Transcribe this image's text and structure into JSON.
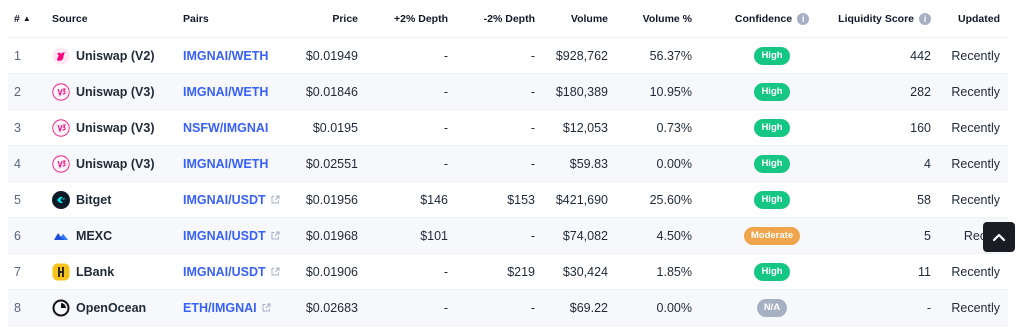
{
  "headers": {
    "num": "#",
    "sort_glyph": "▲",
    "source": "Source",
    "pairs": "Pairs",
    "price": "Price",
    "depth_plus": "+2% Depth",
    "depth_minus": "-2% Depth",
    "volume": "Volume",
    "volume_pct": "Volume %",
    "confidence": "Confidence",
    "liquidity": "Liquidity Score",
    "updated": "Updated"
  },
  "rows": [
    {
      "num": "1",
      "source": "Uniswap (V2)",
      "logo": "uniswap-v2-icon",
      "pair": "IMGNAI/WETH",
      "ext": false,
      "price": "$0.01949",
      "depth_plus": "-",
      "depth_minus": "-",
      "volume": "$928,762",
      "volume_pct": "56.37%",
      "confidence": "High",
      "liquidity": "442",
      "updated": "Recently"
    },
    {
      "num": "2",
      "source": "Uniswap (V3)",
      "logo": "uniswap-v3-icon",
      "pair": "IMGNAI/WETH",
      "ext": false,
      "price": "$0.01846",
      "depth_plus": "-",
      "depth_minus": "-",
      "volume": "$180,389",
      "volume_pct": "10.95%",
      "confidence": "High",
      "liquidity": "282",
      "updated": "Recently"
    },
    {
      "num": "3",
      "source": "Uniswap (V3)",
      "logo": "uniswap-v3-icon",
      "pair": "NSFW/IMGNAI",
      "ext": false,
      "price": "$0.0195",
      "depth_plus": "-",
      "depth_minus": "-",
      "volume": "$12,053",
      "volume_pct": "0.73%",
      "confidence": "High",
      "liquidity": "160",
      "updated": "Recently"
    },
    {
      "num": "4",
      "source": "Uniswap (V3)",
      "logo": "uniswap-v3-icon",
      "pair": "IMGNAI/WETH",
      "ext": false,
      "price": "$0.02551",
      "depth_plus": "-",
      "depth_minus": "-",
      "volume": "$59.83",
      "volume_pct": "0.00%",
      "confidence": "High",
      "liquidity": "4",
      "updated": "Recently"
    },
    {
      "num": "5",
      "source": "Bitget",
      "logo": "bitget-icon",
      "pair": "IMGNAI/USDT",
      "ext": true,
      "price": "$0.01956",
      "depth_plus": "$146",
      "depth_minus": "$153",
      "volume": "$421,690",
      "volume_pct": "25.60%",
      "confidence": "High",
      "liquidity": "58",
      "updated": "Recently"
    },
    {
      "num": "6",
      "source": "MEXC",
      "logo": "mexc-icon",
      "pair": "IMGNAI/USDT",
      "ext": true,
      "price": "$0.01968",
      "depth_plus": "$101",
      "depth_minus": "-",
      "volume": "$74,082",
      "volume_pct": "4.50%",
      "confidence": "Moderate",
      "liquidity": "5",
      "updated": "Recen"
    },
    {
      "num": "7",
      "source": "LBank",
      "logo": "lbank-icon",
      "pair": "IMGNAI/USDT",
      "ext": true,
      "price": "$0.01906",
      "depth_plus": "-",
      "depth_minus": "$219",
      "volume": "$30,424",
      "volume_pct": "1.85%",
      "confidence": "High",
      "liquidity": "11",
      "updated": "Recently"
    },
    {
      "num": "8",
      "source": "OpenOcean",
      "logo": "openocean-icon",
      "pair": "ETH/IMGNAI",
      "ext": true,
      "price": "$0.02683",
      "depth_plus": "-",
      "depth_minus": "-",
      "volume": "$69.22",
      "volume_pct": "0.00%",
      "confidence": "N/A",
      "liquidity": "-",
      "updated": "Recently"
    }
  ],
  "colors": {
    "link": "#3861fb",
    "high": "#16c784",
    "moderate": "#f0a44b",
    "na": "#a6b0c3",
    "alt_row": "#f7f8fc"
  }
}
